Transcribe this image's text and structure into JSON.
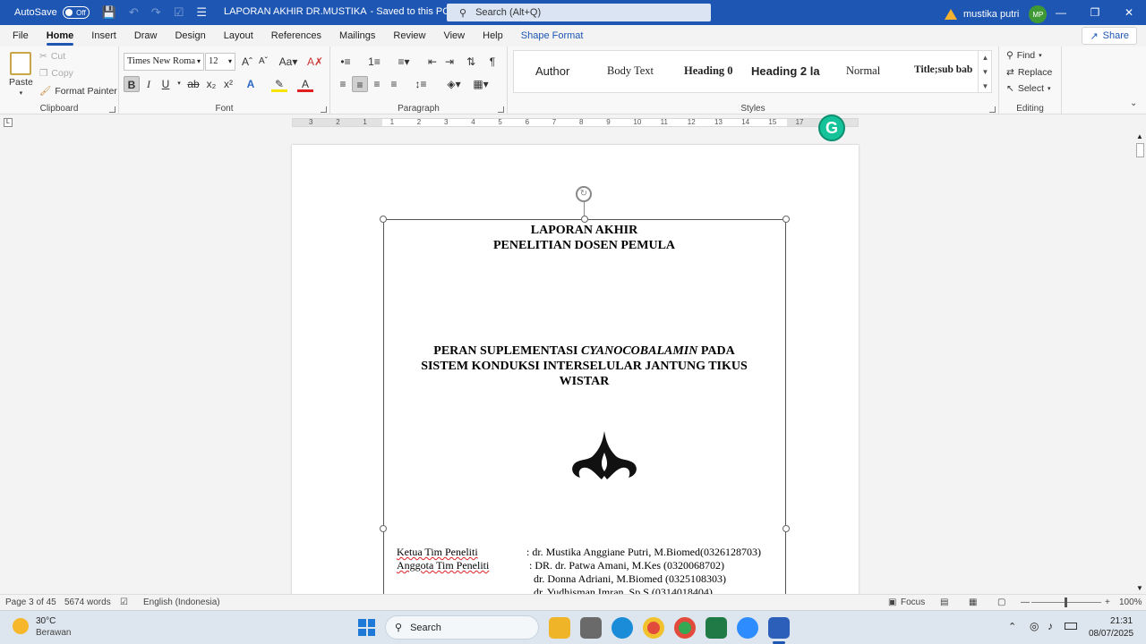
{
  "titlebar": {
    "autosave_label": "AutoSave",
    "autosave_state": "Off",
    "doc_title": "LAPORAN AKHIR DR.MUSTIKA",
    "save_state": "-  Saved to this PC",
    "search_placeholder": "Search (Alt+Q)",
    "user_name": "mustika putri",
    "user_initials": "MP"
  },
  "menu": {
    "items": [
      "File",
      "Home",
      "Insert",
      "Draw",
      "Design",
      "Layout",
      "References",
      "Mailings",
      "Review",
      "View",
      "Help",
      "Shape Format"
    ],
    "active": "Home",
    "share_label": "Share"
  },
  "ribbon": {
    "clipboard": {
      "paste": "Paste",
      "cut": "Cut",
      "copy": "Copy",
      "format_painter": "Format Painter",
      "label": "Clipboard"
    },
    "font": {
      "family": "Times New Roma",
      "size": "12",
      "label": "Font"
    },
    "paragraph": {
      "label": "Paragraph"
    },
    "styles": {
      "items": [
        "Author",
        "Body Text",
        "Heading 0",
        "Heading 2 la",
        "Normal",
        "Title;sub bab"
      ],
      "label": "Styles"
    },
    "editing": {
      "find": "Find",
      "replace": "Replace",
      "select": "Select",
      "label": "Editing"
    }
  },
  "ruler": {
    "numbers": [
      "3",
      "2",
      "1",
      "1",
      "2",
      "3",
      "4",
      "5",
      "6",
      "7",
      "8",
      "9",
      "10",
      "11",
      "12",
      "13",
      "14",
      "15",
      "17"
    ]
  },
  "document": {
    "title_line1": "LAPORAN AKHIR",
    "title_line2": "PENELITIAN DOSEN PEMULA",
    "research_pre": "PERAN  SUPLEMENTASI ",
    "research_italic": "CYANOCOBALAMIN",
    "research_post": " PADA",
    "research_line2": "SISTEM KONDUKSI INTERSELULAR JANTUNG TIKUS",
    "research_line3": "WISTAR",
    "team": {
      "ketua_label": "Ketua  Tim Peneliti",
      "ketua_value": ": dr. Mustika Anggiane Putri, M.Biomed(0326128703)",
      "anggota_label": "Anggota Tim Peneliti",
      "anggota_1": ": DR. dr. Patwa Amani, M.Kes (0320068702)",
      "anggota_2": "dr. Donna Adriani, M.Biomed (0325108303)",
      "anggota_3": "dr. Yudhisman Imran, Sp.S (0314018404)"
    }
  },
  "status": {
    "page": "Page 3 of 45",
    "words": "5674 words",
    "language": "English (Indonesia)",
    "focus": "Focus",
    "zoom": "100%"
  },
  "taskbar": {
    "weather_temp": "30°C",
    "weather_desc": "Berawan",
    "search_label": "Search",
    "time": "21:31",
    "date": "08/07/2025"
  },
  "colors": {
    "brand": "#1e56b3",
    "grammarly": "#15c39a"
  }
}
